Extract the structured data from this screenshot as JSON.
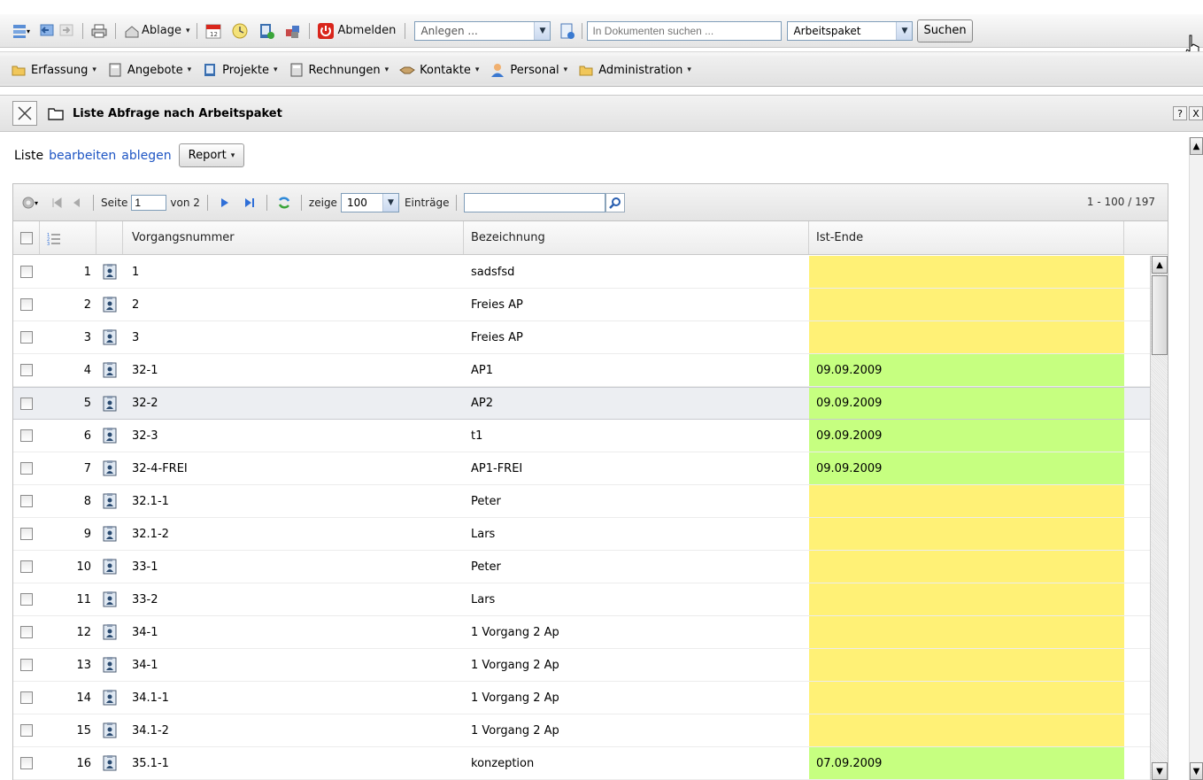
{
  "toolbar": {
    "ablage_label": "Ablage",
    "abmelden_label": "Abmelden",
    "anlegen_placeholder": "Anlegen ...",
    "doc_search_placeholder": "In Dokumenten suchen ...",
    "search_type_value": "Arbeitspaket",
    "search_button_label": "Suchen"
  },
  "menu": {
    "items": [
      {
        "label": "Erfassung"
      },
      {
        "label": "Angebote"
      },
      {
        "label": "Projekte"
      },
      {
        "label": "Rechnungen"
      },
      {
        "label": "Kontakte"
      },
      {
        "label": "Personal"
      },
      {
        "label": "Administration"
      }
    ]
  },
  "panel": {
    "title": "Liste Abfrage nach Arbeitspaket",
    "help_label": "?",
    "close_label": "X"
  },
  "liste": {
    "prefix": "Liste",
    "edit_link": "bearbeiten",
    "save_link": "ablegen",
    "report_label": "Report"
  },
  "pager": {
    "page_label": "Seite",
    "page_value": "1",
    "of_label": "von 2",
    "show_label": "zeige",
    "per_page_value": "100",
    "entries_label": "Einträge",
    "filter_value": "",
    "count_label": "1 - 100 / 197"
  },
  "table": {
    "columns": [
      "Vorgangsnummer",
      "Bezeichnung",
      "Ist-Ende"
    ],
    "rows": [
      {
        "n": "1",
        "vn": "1",
        "bz": "sadsfsd",
        "ie": "",
        "status": "yellow"
      },
      {
        "n": "2",
        "vn": "2",
        "bz": "Freies AP",
        "ie": "",
        "status": "yellow"
      },
      {
        "n": "3",
        "vn": "3",
        "bz": "Freies AP",
        "ie": "",
        "status": "yellow"
      },
      {
        "n": "4",
        "vn": "32-1",
        "bz": "AP1",
        "ie": "09.09.2009",
        "status": "green"
      },
      {
        "n": "5",
        "vn": "32-2",
        "bz": "AP2",
        "ie": "09.09.2009",
        "status": "green"
      },
      {
        "n": "6",
        "vn": "32-3",
        "bz": "t1",
        "ie": "09.09.2009",
        "status": "green"
      },
      {
        "n": "7",
        "vn": "32-4-FREI",
        "bz": "AP1-FREI",
        "ie": "09.09.2009",
        "status": "green"
      },
      {
        "n": "8",
        "vn": "32.1-1",
        "bz": "Peter",
        "ie": "",
        "status": "yellow"
      },
      {
        "n": "9",
        "vn": "32.1-2",
        "bz": "Lars",
        "ie": "",
        "status": "yellow"
      },
      {
        "n": "10",
        "vn": "33-1",
        "bz": "Peter",
        "ie": "",
        "status": "yellow"
      },
      {
        "n": "11",
        "vn": "33-2",
        "bz": "Lars",
        "ie": "",
        "status": "yellow"
      },
      {
        "n": "12",
        "vn": "34-1",
        "bz": "1 Vorgang 2 Ap",
        "ie": "",
        "status": "yellow"
      },
      {
        "n": "13",
        "vn": "34-1",
        "bz": "1 Vorgang 2 Ap",
        "ie": "",
        "status": "yellow"
      },
      {
        "n": "14",
        "vn": "34.1-1",
        "bz": "1 Vorgang 2 Ap",
        "ie": "",
        "status": "yellow"
      },
      {
        "n": "15",
        "vn": "34.1-2",
        "bz": "1 Vorgang 2 Ap",
        "ie": "",
        "status": "yellow"
      },
      {
        "n": "16",
        "vn": "35.1-1",
        "bz": "konzeption",
        "ie": "07.09.2009",
        "status": "green"
      }
    ],
    "selected_row": "5"
  },
  "colors": {
    "status_yellow": "#fff176",
    "status_green": "#c6ff80",
    "link_blue": "#1f56c4",
    "abmelden_red": "#d9261c"
  }
}
